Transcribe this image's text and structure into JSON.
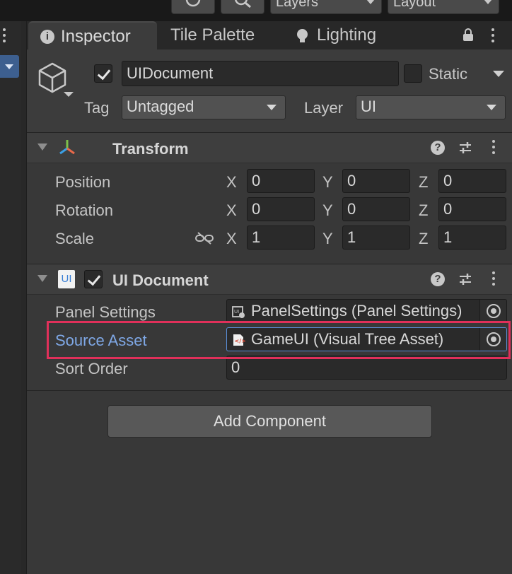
{
  "toolbar": {
    "layers_label": "Layers",
    "layout_label": "Layout"
  },
  "tabs": [
    {
      "label": "Inspector"
    },
    {
      "label": "Tile Palette"
    },
    {
      "label": "Lighting"
    }
  ],
  "header": {
    "object_name": "UIDocument",
    "active": true,
    "static_label": "Static",
    "tag_label": "Tag",
    "tag_value": "Untagged",
    "layer_label": "Layer",
    "layer_value": "UI"
  },
  "transform": {
    "title": "Transform",
    "rows": [
      {
        "label": "Position",
        "x": "0",
        "y": "0",
        "z": "0"
      },
      {
        "label": "Rotation",
        "x": "0",
        "y": "0",
        "z": "0"
      },
      {
        "label": "Scale",
        "x": "1",
        "y": "1",
        "z": "1"
      }
    ],
    "axis_x": "X",
    "axis_y": "Y",
    "axis_z": "Z"
  },
  "ui_document": {
    "title": "UI Document",
    "icon_text": "UI",
    "enabled": true,
    "panel_settings_label": "Panel Settings",
    "panel_settings_value": "PanelSettings (Panel Settings)",
    "source_asset_label": "Source Asset",
    "source_asset_value": "GameUI (Visual Tree Asset)",
    "sort_order_label": "Sort Order",
    "sort_order_value": "0"
  },
  "add_component_label": "Add Component",
  "colors": {
    "accent_blue": "#7fa8e6",
    "highlight": "#e0305a",
    "selection": "#3d5f8f"
  }
}
